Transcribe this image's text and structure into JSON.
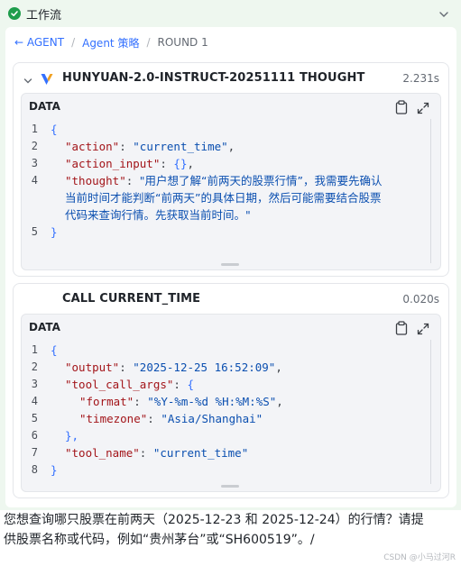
{
  "workflow": {
    "title": "工作流"
  },
  "breadcrumb": {
    "back_label": "← AGENT",
    "strategy": "Agent 策略",
    "current": "ROUND 1"
  },
  "thought_card": {
    "title": "HUNYUAN-2.0-INSTRUCT-20251111 THOUGHT",
    "time": "2.231s",
    "data_label": "DATA",
    "lines": {
      "l1": {
        "n": "1",
        "open": "{"
      },
      "l2": {
        "n": "2",
        "key": "\"action\"",
        "colon": ": ",
        "value": "\"current_time\"",
        "tail": ","
      },
      "l3": {
        "n": "3",
        "key": "\"action_input\"",
        "colon": ": ",
        "value": "{}",
        "tail": ","
      },
      "l4": {
        "n": "4",
        "key": "\"thought\"",
        "colon": ": ",
        "w1": "\"用户想了解“前两天的股票行情”，我需要先确认",
        "w2": "当前时间才能判断“前两天”的具体日期，然后可能需要结合股票",
        "w3": "代码来查询行情。先获取当前时间。\""
      },
      "l5": {
        "n": "5",
        "close": "}"
      }
    }
  },
  "call_card": {
    "title": "CALL CURRENT_TIME",
    "time": "0.020s",
    "data_label": "DATA",
    "lines": {
      "l1": {
        "n": "1",
        "open": "{"
      },
      "l2": {
        "n": "2",
        "key": "\"output\"",
        "colon": ": ",
        "value": "\"2025-12-25 16:52:09\"",
        "tail": ","
      },
      "l3": {
        "n": "3",
        "key": "\"tool_call_args\"",
        "colon": ": ",
        "open": "{"
      },
      "l4": {
        "n": "4",
        "key": "\"format\"",
        "colon": ": ",
        "value": "\"%Y-%m-%d %H:%M:%S\"",
        "tail": ","
      },
      "l5": {
        "n": "5",
        "key": "\"timezone\"",
        "colon": ": ",
        "value": "\"Asia/Shanghai\""
      },
      "l6": {
        "n": "6",
        "close": "},"
      },
      "l7": {
        "n": "7",
        "key": "\"tool_name\"",
        "colon": ": ",
        "value": "\"current_time\""
      },
      "l8": {
        "n": "8",
        "close": "}"
      }
    }
  },
  "message": {
    "line1": "您想查询哪只股票在前两天（2025-12-23 和 2025-12-24）的行情？请提",
    "line2": "供股票名称或代码，例如“贵州茅台”或“SH600519”。/"
  },
  "watermark": "CSDN @小马过河R",
  "colors": {
    "accent": "#3370ff",
    "success": "#1f9d4c",
    "json_key": "#a3151a",
    "json_string": "#0b4fb0",
    "panel_bg": "#eef7ef"
  },
  "icons": [
    "check-circle-icon",
    "chevron-down-icon",
    "model-logo-icon",
    "clipboard-icon",
    "expand-icon"
  ]
}
